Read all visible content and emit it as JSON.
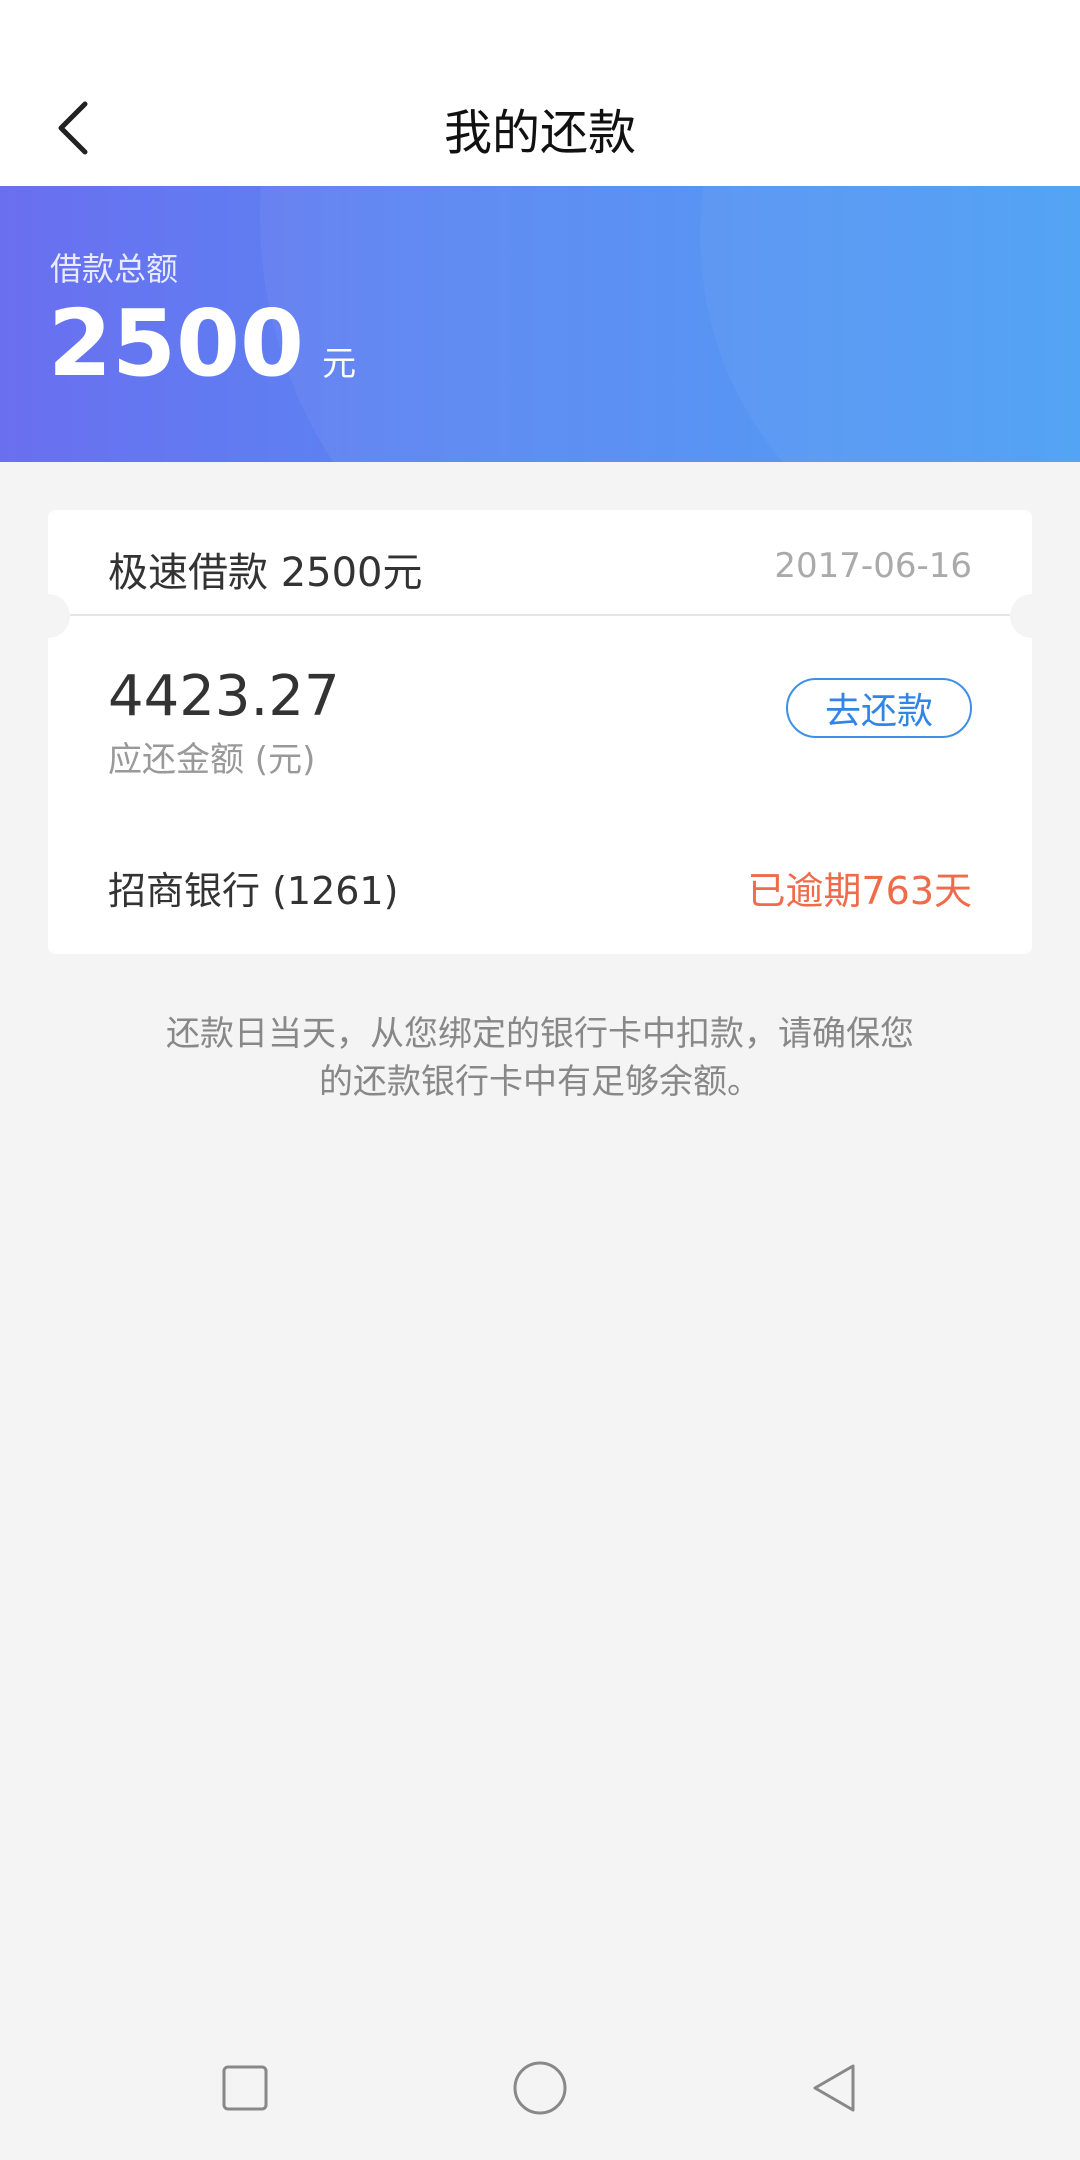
{
  "header": {
    "title": "我的还款",
    "back_icon": "chevron-left-icon"
  },
  "banner": {
    "label": "借款总额",
    "amount": "2500",
    "unit": "元"
  },
  "loan_card": {
    "name": "极速借款 2500元",
    "date": "2017-06-16",
    "due_amount": "4423.27",
    "due_label": "应还金额 (元)",
    "repay_button": "去还款",
    "bank": "招商银行 (1261)",
    "status": "已逾期763天",
    "status_color": "#ef6b4a",
    "accent_color": "#2f86e6"
  },
  "notice": {
    "line1": "还款日当天，从您绑定的银行卡中扣款，请确保您",
    "line2": "的还款银行卡中有足够余额。"
  },
  "system_nav": {
    "recents_icon": "square-recents-icon",
    "home_icon": "circle-home-icon",
    "back_icon": "triangle-back-icon"
  }
}
